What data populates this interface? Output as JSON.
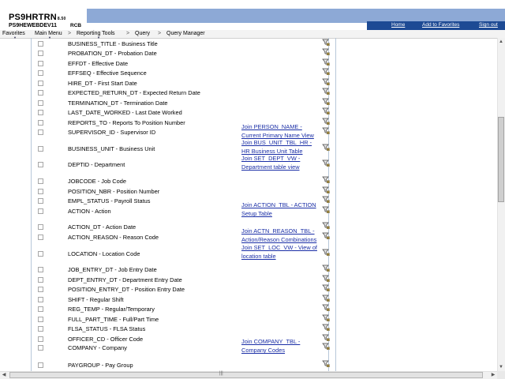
{
  "header": {
    "system": "PS9HRTRN",
    "version": "8.50",
    "database": "PS9HEWEBDEV11",
    "user": "RCB",
    "links": {
      "home": "Home",
      "favorites": "Add to Favorites",
      "signout": "Sign out"
    }
  },
  "nav": {
    "items": [
      "Favorites",
      "Main Menu",
      "Reporting Tools",
      "Query",
      "Query Manager"
    ],
    "separator": ">"
  },
  "icon_glyph": "criteria-funnel-icon",
  "rows": [
    {
      "label": "BUSINESS_TITLE - Business Title"
    },
    {
      "label": "PROBATION_DT - Probation Date"
    },
    {
      "label": "EFFDT - Effective Date"
    },
    {
      "label": "EFFSEQ - Effective Sequence"
    },
    {
      "label": "HIRE_DT - First Start Date"
    },
    {
      "label": "EXPECTED_RETURN_DT - Expected Return Date"
    },
    {
      "label": "TERMINATION_DT - Termination Date"
    },
    {
      "label": "LAST_DATE_WORKED - Last Date Worked"
    },
    {
      "label": "REPORTS_TO - Reports To Position Number"
    },
    {
      "label": "SUPERVISOR_ID - Supervisor ID",
      "link": [
        "Join PERSON_NAME -",
        "Current Primary Name View"
      ]
    },
    {
      "label": "BUSINESS_UNIT - Business Unit",
      "link": [
        "Join BUS_UNIT_TBL_HR -",
        "HR Business Unit Table"
      ]
    },
    {
      "label": "DEPTID - Department",
      "link": [
        "Join SET_DEPT_VW -",
        "Department table view"
      ]
    },
    {
      "label": "JOBCODE - Job Code"
    },
    {
      "label": "POSITION_NBR - Position Number"
    },
    {
      "label": "EMPL_STATUS - Payroll Status"
    },
    {
      "label": "ACTION - Action",
      "link": [
        "Join ACTION_TBL - ACTION",
        "Setup Table"
      ]
    },
    {
      "label": "ACTION_DT - Action Date"
    },
    {
      "label": "ACTION_REASON - Reason Code",
      "link": [
        "Join ACTN_REASON_TBL -",
        "Action/Reason Combinations"
      ]
    },
    {
      "label": "LOCATION - Location Code",
      "link": [
        "Join SET_LOC_VW - View of",
        "location table"
      ]
    },
    {
      "label": "JOB_ENTRY_DT - Job Entry Date"
    },
    {
      "label": "DEPT_ENTRY_DT - Department Entry Date"
    },
    {
      "label": "POSITION_ENTRY_DT - Position Entry Date"
    },
    {
      "label": "SHIFT - Regular Shift"
    },
    {
      "label": "REG_TEMP - Regular/Temporary"
    },
    {
      "label": "FULL_PART_TIME - Full/Part Time"
    },
    {
      "label": "FLSA_STATUS - FLSA Status"
    },
    {
      "label": "OFFICER_CD - Officer Code"
    },
    {
      "label": "COMPANY - Company",
      "link": [
        "Join COMPANY_TBL -",
        "Company Codes"
      ]
    },
    {
      "label": "PAYGROUP - Pay Group"
    }
  ]
}
